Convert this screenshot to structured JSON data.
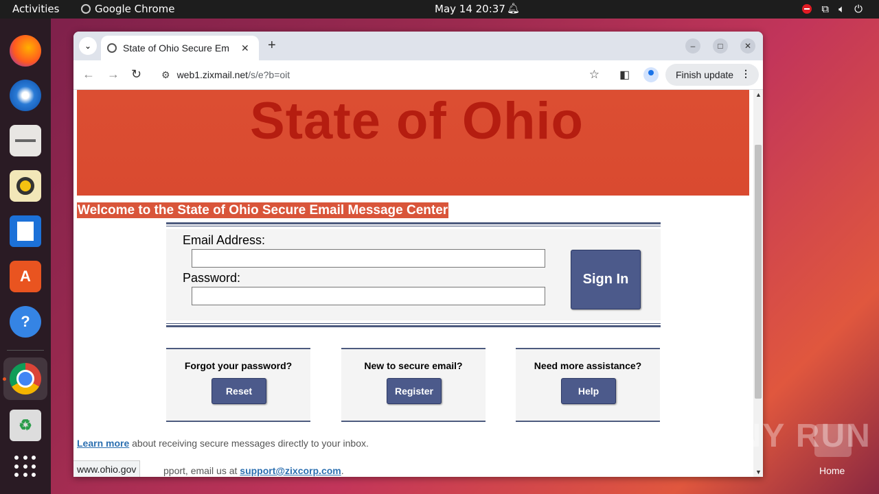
{
  "topbar": {
    "activities": "Activities",
    "app_name": "Google Chrome",
    "clock": "May 14  20:37"
  },
  "dock": {
    "items": [
      "firefox-icon",
      "thunderbird-icon",
      "files-icon",
      "rhythmbox-icon",
      "libreoffice-writer-icon",
      "app-center-icon",
      "help-icon",
      "chrome-icon",
      "trash-icon",
      "show-apps-icon"
    ]
  },
  "browser": {
    "tab_title": "State of Ohio Secure Em",
    "url_host": "web1.zixmail.net",
    "url_path": "/s/e?b=oit",
    "finish_update": "Finish update",
    "status_url": "www.ohio.gov"
  },
  "page": {
    "banner_text": "State of Ohio",
    "welcome": "Welcome to the State of Ohio Secure Email Message Center",
    "email_label": "Email Address:",
    "password_label": "Password:",
    "email_value": "",
    "password_value": "",
    "signin": "Sign In",
    "panels": [
      {
        "question": "Forgot your password?",
        "button": "Reset"
      },
      {
        "question": "New to secure email?",
        "button": "Register"
      },
      {
        "question": "Need more assistance?",
        "button": "Help"
      }
    ],
    "learn_link": "Learn more",
    "learn_text": " about receiving secure messages directly to your inbox.",
    "support_text": "pport, email us at ",
    "support_link": "support@zixcorp.com",
    "support_end": "."
  },
  "desktop": {
    "watermark": "ANY RUN",
    "home_label": "Home"
  },
  "colors": {
    "banner": "#dc4e32",
    "banner_text": "#b51d10",
    "button": "#4c5a8b",
    "rule": "#4c5a7e"
  }
}
